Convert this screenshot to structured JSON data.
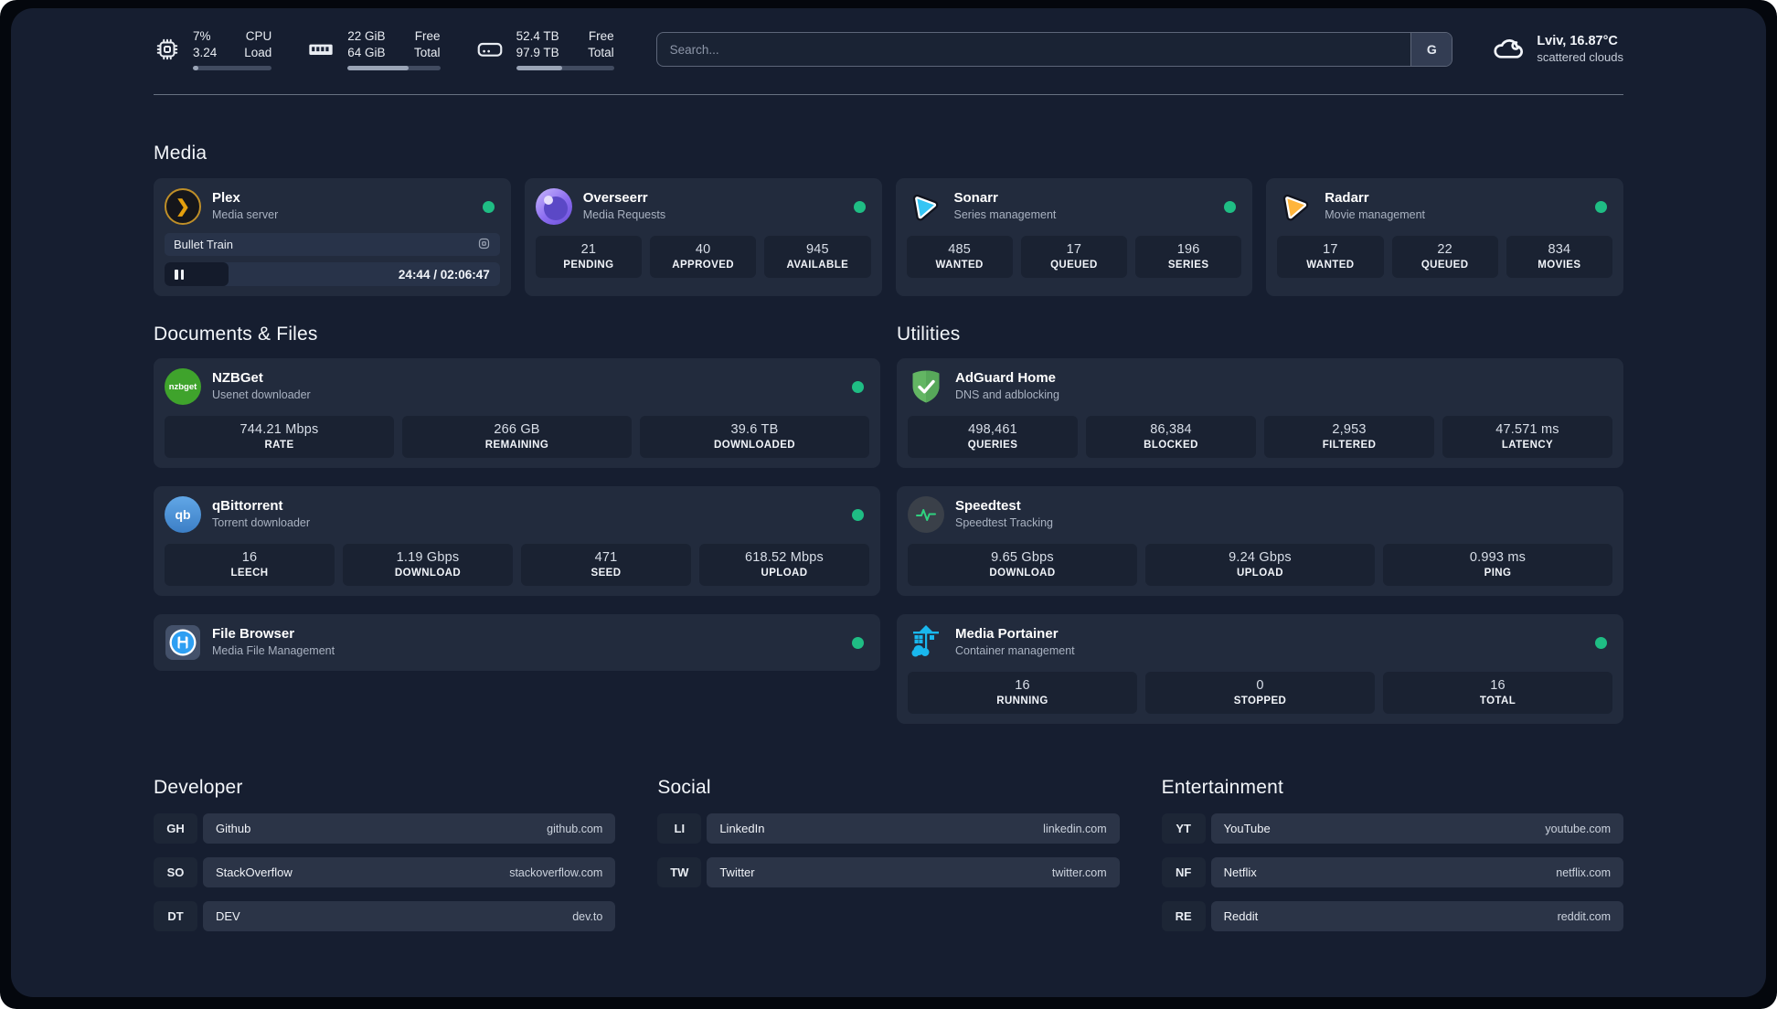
{
  "colors": {
    "status_online": "#1fbd84",
    "page_bg": "#161e30",
    "card_bg": "#222b3d"
  },
  "topbar": {
    "cpu": {
      "line1_value": "7%",
      "line2_value": "3.24",
      "line1_label": "CPU",
      "line2_label": "Load",
      "progress_pct": 7
    },
    "memory": {
      "line1_value": "22 GiB",
      "line2_value": "64 GiB",
      "line1_label": "Free",
      "line2_label": "Total",
      "progress_pct": 66
    },
    "disk": {
      "line1_value": "52.4 TB",
      "line2_value": "97.9 TB",
      "line1_label": "Free",
      "line2_label": "Total",
      "progress_pct": 47
    },
    "search": {
      "placeholder": "Search...",
      "engine_button": "G"
    },
    "weather": {
      "headline": "Lviv, 16.87°C",
      "condition": "scattered clouds"
    }
  },
  "sections": {
    "media": {
      "title": "Media",
      "plex": {
        "name": "Plex",
        "description": "Media server",
        "icon_label": "❯",
        "now_playing": "Bullet Train",
        "time": "24:44 / 02:06:47",
        "progress_pct": 19,
        "online": true
      },
      "overseerr": {
        "name": "Overseerr",
        "description": "Media Requests",
        "online": true,
        "stats": [
          {
            "value": "21",
            "label": "PENDING"
          },
          {
            "value": "40",
            "label": "APPROVED"
          },
          {
            "value": "945",
            "label": "AVAILABLE"
          }
        ]
      },
      "sonarr": {
        "name": "Sonarr",
        "description": "Series management",
        "online": true,
        "stats": [
          {
            "value": "485",
            "label": "WANTED"
          },
          {
            "value": "17",
            "label": "QUEUED"
          },
          {
            "value": "196",
            "label": "SERIES"
          }
        ]
      },
      "radarr": {
        "name": "Radarr",
        "description": "Movie management",
        "online": true,
        "stats": [
          {
            "value": "17",
            "label": "WANTED"
          },
          {
            "value": "22",
            "label": "QUEUED"
          },
          {
            "value": "834",
            "label": "MOVIES"
          }
        ]
      }
    },
    "documents": {
      "title": "Documents & Files",
      "nzbget": {
        "name": "NZBGet",
        "description": "Usenet downloader",
        "icon_label": "nzbget",
        "online": true,
        "stats": [
          {
            "value": "744.21 Mbps",
            "label": "RATE"
          },
          {
            "value": "266 GB",
            "label": "REMAINING"
          },
          {
            "value": "39.6 TB",
            "label": "DOWNLOADED"
          }
        ]
      },
      "qbittorrent": {
        "name": "qBittorrent",
        "description": "Torrent downloader",
        "icon_label": "qb",
        "online": true,
        "stats": [
          {
            "value": "16",
            "label": "LEECH"
          },
          {
            "value": "1.19 Gbps",
            "label": "DOWNLOAD"
          },
          {
            "value": "471",
            "label": "SEED"
          },
          {
            "value": "618.52 Mbps",
            "label": "UPLOAD"
          }
        ]
      },
      "filebrowser": {
        "name": "File Browser",
        "description": "Media File Management",
        "online": true
      }
    },
    "utilities": {
      "title": "Utilities",
      "adguard": {
        "name": "AdGuard Home",
        "description": "DNS and adblocking",
        "stats": [
          {
            "value": "498,461",
            "label": "QUERIES"
          },
          {
            "value": "86,384",
            "label": "BLOCKED"
          },
          {
            "value": "2,953",
            "label": "FILTERED"
          },
          {
            "value": "47.571 ms",
            "label": "LATENCY"
          }
        ]
      },
      "speedtest": {
        "name": "Speedtest",
        "description": "Speedtest Tracking",
        "stats": [
          {
            "value": "9.65 Gbps",
            "label": "DOWNLOAD"
          },
          {
            "value": "9.24 Gbps",
            "label": "UPLOAD"
          },
          {
            "value": "0.993 ms",
            "label": "PING"
          }
        ]
      },
      "portainer": {
        "name": "Media Portainer",
        "description": "Container management",
        "online": true,
        "stats": [
          {
            "value": "16",
            "label": "RUNNING"
          },
          {
            "value": "0",
            "label": "STOPPED"
          },
          {
            "value": "16",
            "label": "TOTAL"
          }
        ]
      }
    }
  },
  "links": {
    "developer": {
      "title": "Developer",
      "items": [
        {
          "abbr": "GH",
          "name": "Github",
          "domain": "github.com"
        },
        {
          "abbr": "SO",
          "name": "StackOverflow",
          "domain": "stackoverflow.com"
        },
        {
          "abbr": "DT",
          "name": "DEV",
          "domain": "dev.to"
        }
      ]
    },
    "social": {
      "title": "Social",
      "items": [
        {
          "abbr": "LI",
          "name": "LinkedIn",
          "domain": "linkedin.com"
        },
        {
          "abbr": "TW",
          "name": "Twitter",
          "domain": "twitter.com"
        }
      ]
    },
    "entertainment": {
      "title": "Entertainment",
      "items": [
        {
          "abbr": "YT",
          "name": "YouTube",
          "domain": "youtube.com"
        },
        {
          "abbr": "NF",
          "name": "Netflix",
          "domain": "netflix.com"
        },
        {
          "abbr": "RE",
          "name": "Reddit",
          "domain": "reddit.com"
        }
      ]
    }
  }
}
